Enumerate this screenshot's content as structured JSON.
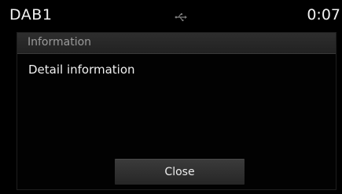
{
  "status_bar": {
    "source": "DAB1",
    "usb_icon": "usb-icon",
    "clock": "0:07"
  },
  "dialog": {
    "title": "Information",
    "body": "Detail information",
    "close_label": "Close"
  }
}
